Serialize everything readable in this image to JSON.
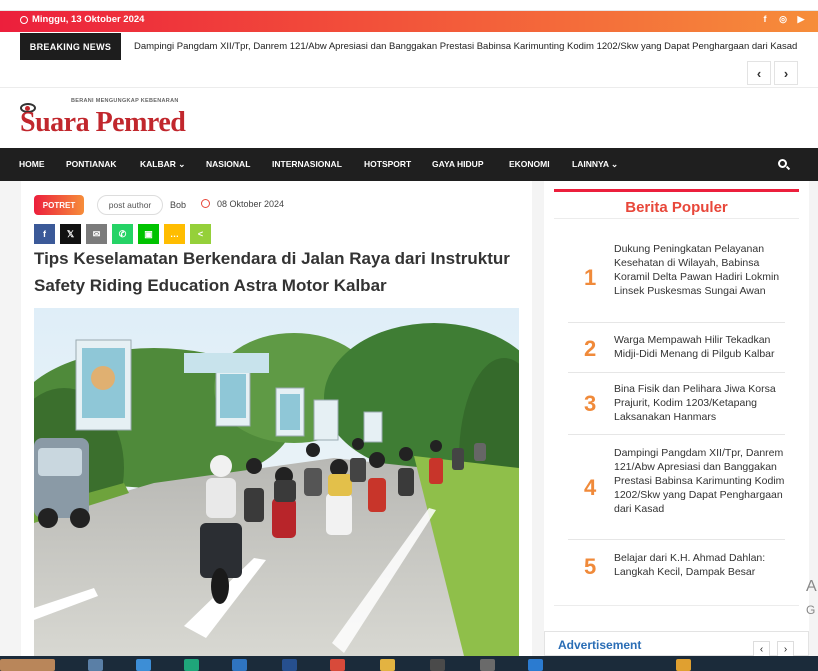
{
  "topbar": {
    "date": "Minggu, 13 Oktober 2024",
    "social": [
      "f",
      "◎",
      "▶"
    ]
  },
  "breaking": {
    "label": "BREAKING NEWS",
    "headline": "Dampingi Pangdam XII/Tpr, Danrem 121/Abw Apresiasi dan Banggakan Prestasi Babinsa Karimunting Kodim 1202/Skw yang Dapat Penghargaan dari Kasad",
    "prev": "‹",
    "next": "›"
  },
  "logo": {
    "tagline": "BERANI MENGUNGKAP KEBENARAN",
    "name": "Suara Pemred"
  },
  "nav": {
    "items": [
      "HOME",
      "PONTIANAK",
      "KALBAR ⌄",
      "NASIONAL",
      "INTERNASIONAL",
      "HOTSPORT",
      "GAYA HIDUP",
      "EKONOMI",
      "LAINNYA ⌄"
    ]
  },
  "article": {
    "category": "POTRET",
    "author_avatar_alt": "post author",
    "author": "Bob",
    "date": "08 Oktober 2024",
    "share": [
      {
        "icon": "facebook-icon",
        "glyph": "f",
        "color": "#3b5998"
      },
      {
        "icon": "x-icon",
        "glyph": "𝕏",
        "color": "#111111"
      },
      {
        "icon": "email-icon",
        "glyph": "✉",
        "color": "#7b7b7b"
      },
      {
        "icon": "whatsapp-icon",
        "glyph": "✆",
        "color": "#25d366"
      },
      {
        "icon": "line-icon",
        "glyph": "▣",
        "color": "#00c300"
      },
      {
        "icon": "sms-icon",
        "glyph": "…",
        "color": "#ffbd00"
      },
      {
        "icon": "share-icon",
        "glyph": "<",
        "color": "#95d03a"
      }
    ],
    "title": "Tips Keselamatan Berkendara di Jalan Raya dari Instruktur Safety Riding Education Astra Motor Kalbar"
  },
  "sidebar": {
    "heading": "Berita Populer",
    "items": [
      {
        "num": "1",
        "text": "Dukung Peningkatan Pelayanan Kesehatan di Wilayah, Babinsa Koramil Delta Pawan Hadiri Lokmin Linsek Puskesmas Sungai Awan"
      },
      {
        "num": "2",
        "text": "Warga Mempawah Hilir Tekadkan Midji-Didi Menang di Pilgub Kalbar"
      },
      {
        "num": "3",
        "text": "Bina Fisik dan Pelihara Jiwa Korsa Prajurit, Kodim 1203/Ketapang Laksanakan Hanmars"
      },
      {
        "num": "4",
        "text": "Dampingi Pangdam XII/Tpr, Danrem 121/Abw Apresiasi dan Banggakan Prestasi Babinsa Karimunting Kodim 1202/Skw yang Dapat Penghargaan dari Kasad"
      },
      {
        "num": "5",
        "text": "Belajar dari K.H. Ahmad Dahlan: Langkah Kecil, Dampak Besar"
      }
    ],
    "ad_label": "Advertisement"
  },
  "edge": {
    "a": "A",
    "g": "G"
  },
  "colors": {
    "accent": "#ec1f3c",
    "accent_end": "#f68d3a",
    "nav_bg": "#1f1f1f",
    "number": "#f08a3a"
  }
}
